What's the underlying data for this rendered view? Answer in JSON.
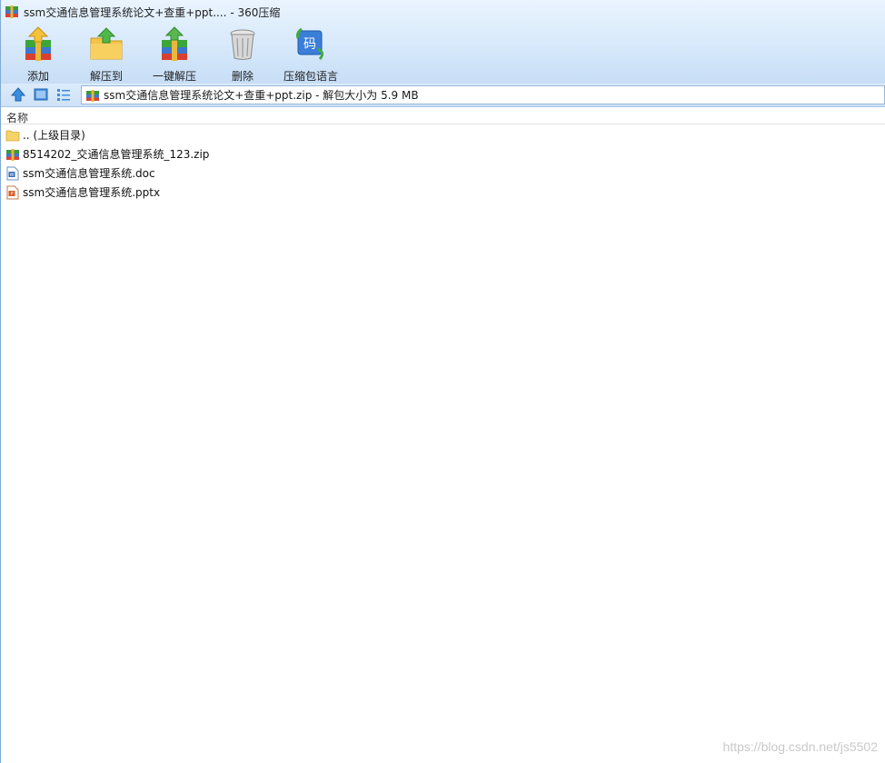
{
  "window": {
    "title": "ssm交通信息管理系统论文+查重+ppt.... - 360压缩"
  },
  "toolbar": {
    "add_label": "添加",
    "extract_to_label": "解压到",
    "one_click_extract_label": "一键解压",
    "delete_label": "删除",
    "encoding_label": "压缩包语言"
  },
  "address": {
    "text": "ssm交通信息管理系统论文+查重+ppt.zip - 解包大小为 5.9 MB"
  },
  "list": {
    "column_name": "名称",
    "items": [
      {
        "name": ".. (上级目录)",
        "icon": "folder-icon"
      },
      {
        "name": "8514202_交通信息管理系统_123.zip",
        "icon": "zip-archive-icon"
      },
      {
        "name": "ssm交通信息管理系统.doc",
        "icon": "word-doc-icon"
      },
      {
        "name": "ssm交通信息管理系统.pptx",
        "icon": "powerpoint-icon"
      }
    ]
  },
  "watermark": "https://blog.csdn.net/js5502",
  "colors": {
    "frame_top": "#eaf4fe",
    "frame_bottom": "#c7def6",
    "accent_blue": "#2f7fd8"
  }
}
